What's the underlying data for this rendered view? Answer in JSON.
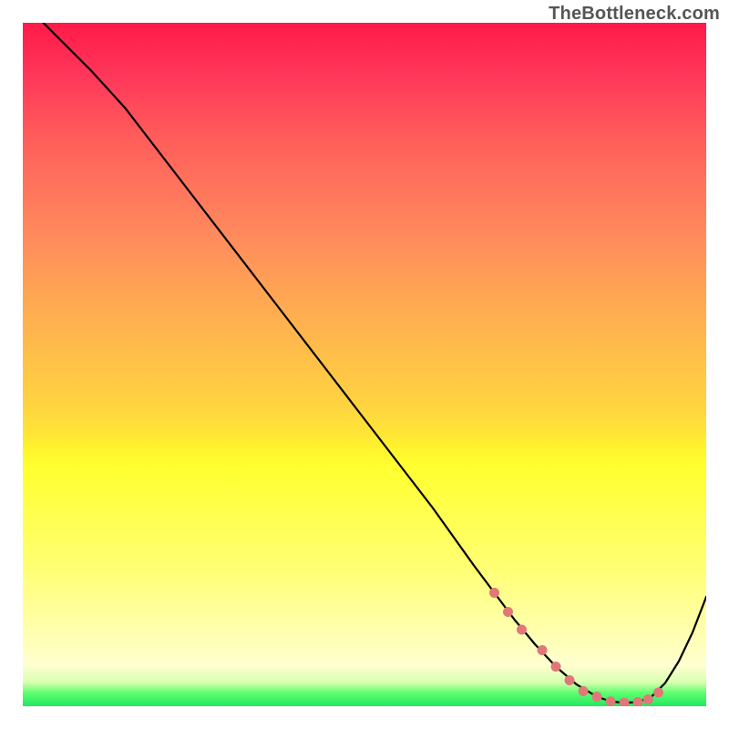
{
  "watermark": "TheBottleneck.com",
  "chart_data": {
    "type": "line",
    "title": "",
    "xlabel": "",
    "ylabel": "",
    "xlim": [
      0,
      100
    ],
    "ylim": [
      0,
      100
    ],
    "gradient_stops": [
      {
        "pos": 0,
        "color": "#ff1a48"
      },
      {
        "pos": 24,
        "color": "#ff745c"
      },
      {
        "pos": 48,
        "color": "#ffbd4a"
      },
      {
        "pos": 65,
        "color": "#ffff30"
      },
      {
        "pos": 94,
        "color": "#ffffd0"
      },
      {
        "pos": 100,
        "color": "#20e860"
      }
    ],
    "series": [
      {
        "name": "bottleneck-curve",
        "color": "#000000",
        "x": [
          3,
          6,
          10,
          15,
          20,
          25,
          30,
          35,
          40,
          45,
          50,
          55,
          60,
          63,
          66,
          69,
          72,
          75,
          78,
          81,
          84,
          86,
          88,
          90,
          92,
          94,
          96,
          98,
          100
        ],
        "y": [
          100,
          97,
          93,
          87.5,
          81,
          74.5,
          68,
          61.5,
          55,
          48.5,
          42,
          35.5,
          29,
          24.8,
          20.6,
          16.6,
          12.6,
          9,
          5.8,
          3.2,
          1.4,
          0.7,
          0.5,
          0.6,
          1.4,
          3.4,
          6.6,
          10.8,
          16
        ]
      }
    ],
    "markers": {
      "name": "highlight-dots",
      "color": "#e07878",
      "x": [
        69,
        71,
        73,
        76,
        78,
        80,
        82,
        84,
        86,
        88,
        90,
        91.5,
        93
      ],
      "y": [
        16.6,
        13.8,
        11.2,
        8.2,
        5.8,
        3.8,
        2.2,
        1.4,
        0.7,
        0.5,
        0.6,
        1.0,
        2.0
      ]
    }
  }
}
